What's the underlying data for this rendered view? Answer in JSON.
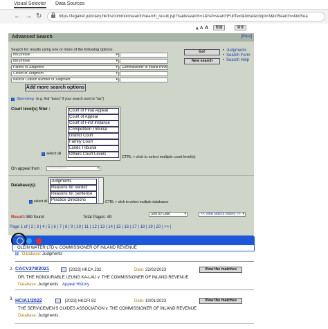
{
  "tabs": [
    "Visual Selector",
    "Data Sources"
  ],
  "url": "https://legalref.judiciary.hk/lrs/common/search/search_result.jsp?isadvsearch=1&hsf=searchFullText&txtselectopt=3&txtSearch=&txtSea",
  "lang_buttons": [
    "繁體",
    "简体"
  ],
  "font_sizes": [
    "A",
    "A",
    "A"
  ],
  "panel": {
    "title": "Advanced Search",
    "print": "[Print]",
    "search_label": "Search for results using one or more of the following options:",
    "rows": [
      {
        "select": "this phrase",
        "text": ""
      },
      {
        "select": "this phrase",
        "text": ""
      },
      {
        "select": "Parties of Judgment",
        "text": "Commissioner of Inland Reve"
      },
      {
        "select": "Coram of Judgment",
        "text": ""
      },
      {
        "select": "Neutral Citation Number of Judgment",
        "text": ""
      }
    ],
    "add_more": "Add more search options",
    "go": "Go!",
    "new_search": "New search",
    "links": [
      "Judgments",
      "Search Form",
      "Search Help"
    ],
    "stemming_label": "Stemming",
    "stemming_hint": "(e.g. find \"taxes\" if your search word is \"tax\")",
    "court_label": "Court level(s) filter :",
    "courts": [
      "Court of Final Appeal",
      "Court of Appeal",
      "Court of First Instance",
      "Competition Tribunal",
      "District Court",
      "Family Court",
      "Lands Tribunal",
      "Others Court Levels"
    ],
    "select_all": "select all",
    "ctrl_hint": "CTRL + click to select multiple court level(s)",
    "appeal_label": "On appeal from :",
    "appeal_value": "----------------",
    "database_label": "Database(s):",
    "databases": [
      "Judgments",
      "Reasons for Verdict",
      "Reasons for Sentence",
      "Practice Directions"
    ],
    "db_select_all": "select all",
    "db_hint": "CTRL + click to select multiple databases"
  },
  "results": {
    "found_label": "Result:",
    "found_value": "489 found",
    "total_pages": "Total Pages: 49",
    "sort": "Sort by Date",
    "history": "<< View search history >>"
  },
  "pages": "Page 1 of | 2 | 3 | 4 | 5 | 6 | 7 | 8 | 9 | 10 | 11 | 12 | 13 | 14 | 15 | 16 | 17 | 18 | 19 | 20 | >> |",
  "popup": {
    "selected_text": "OLEIN WATER LTD v. COMMISSIONER OF INLAND REVENUE",
    "db_label": "Database:",
    "db_value": "Judgments"
  },
  "entries": [
    {
      "num": "2.",
      "case": "CACV278/2021",
      "citation": "[2023] HKCA 232",
      "date_label": "Date:",
      "date": "22/02/2023",
      "title": "DR. THE HONOURABLE LEUNG KA-LAU v. THE COMMISSIONER OF INLAND REVENUE",
      "db_label": "Database:",
      "db_value": "Judgments",
      "extra": "Appeal History",
      "button": "View the matches"
    },
    {
      "num": "3.",
      "case": "HCIA1/2022",
      "citation": "[2023] HKCFI 82",
      "date_label": "Date:",
      "date": "10/01/2023",
      "title": "THE SERVICEMEN'S GUIDES ASSOCIATION v. THE COMMISSIONER OF INLAND REVENUE",
      "db_label": "Database:",
      "db_value": "Judgments",
      "extra": "",
      "button": "View the matches"
    }
  ],
  "colors": {
    "panel": "#cfd6c9",
    "header": "#a9b5a4",
    "link": "#1a3aa5",
    "popup": "#1e56d9"
  }
}
